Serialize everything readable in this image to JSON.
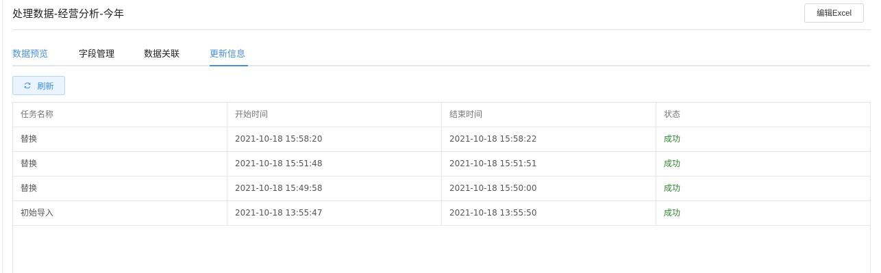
{
  "header": {
    "title": "处理数据-经营分析-今年",
    "edit_button": "编辑Excel"
  },
  "tabs": [
    {
      "label": "数据预览"
    },
    {
      "label": "字段管理"
    },
    {
      "label": "数据关联"
    },
    {
      "label": "更新信息"
    }
  ],
  "active_tab": "更新信息",
  "toolbar": {
    "refresh_label": "刷新"
  },
  "table": {
    "columns": [
      "任务名称",
      "开始时间",
      "结束时间",
      "状态"
    ],
    "rows": [
      {
        "name": "替换",
        "start": "2021-10-18 15:58:20",
        "end": "2021-10-18 15:58:22",
        "status": "成功"
      },
      {
        "name": "替换",
        "start": "2021-10-18 15:51:48",
        "end": "2021-10-18 15:51:51",
        "status": "成功"
      },
      {
        "name": "替换",
        "start": "2021-10-18 15:49:58",
        "end": "2021-10-18 15:50:00",
        "status": "成功"
      },
      {
        "name": "初始导入",
        "start": "2021-10-18 13:55:47",
        "end": "2021-10-18 13:55:50",
        "status": "成功"
      }
    ]
  },
  "colors": {
    "accent": "#4a90d9",
    "success": "#2e8b2e"
  }
}
